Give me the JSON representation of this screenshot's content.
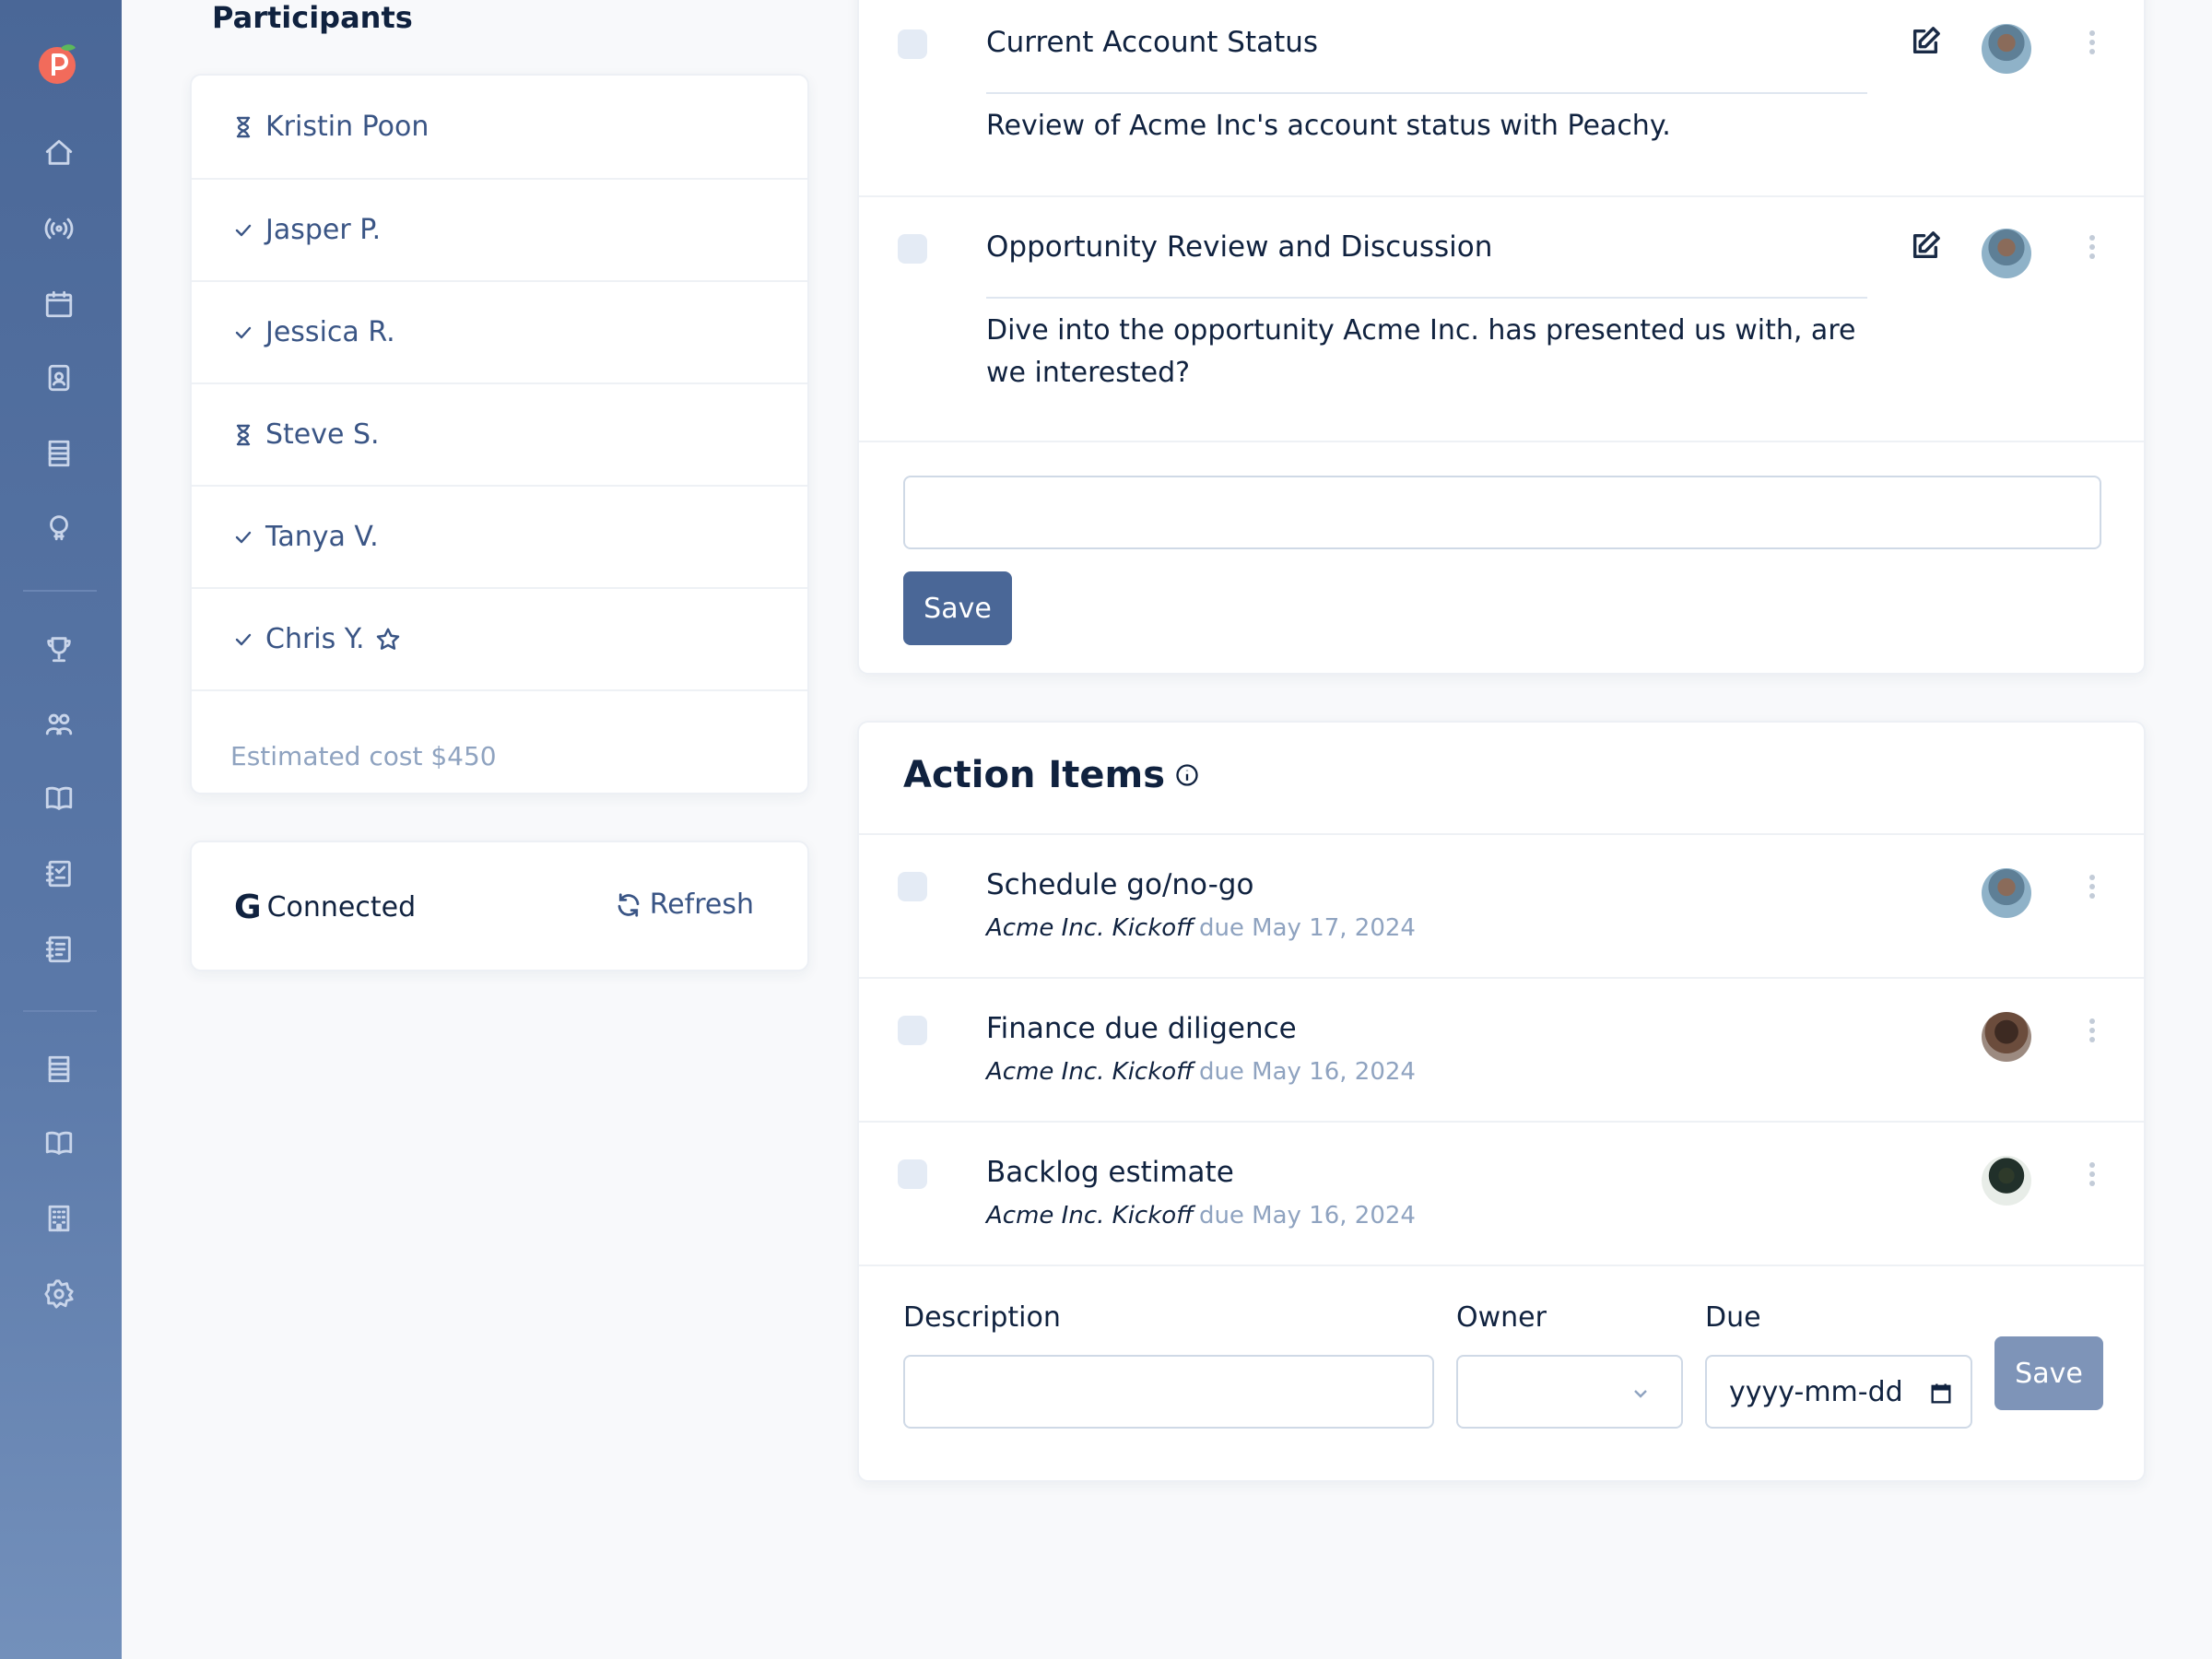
{
  "participants": {
    "title": "Participants",
    "people": [
      {
        "name": "Kristin Poon",
        "status": "pending"
      },
      {
        "name": "Jasper P.",
        "status": "accepted"
      },
      {
        "name": "Jessica R.",
        "status": "accepted"
      },
      {
        "name": "Steve S.",
        "status": "pending"
      },
      {
        "name": "Tanya V.",
        "status": "accepted"
      },
      {
        "name": "Chris Y.",
        "status": "accepted",
        "starred": true
      }
    ],
    "estimated_cost": "Estimated cost $450"
  },
  "calendar": {
    "google_logo": "G",
    "status": "Connected",
    "refresh_label": "Refresh"
  },
  "agenda": {
    "items": [
      {
        "title": "Current Account Status",
        "description": "Review of Acme Inc's account status with Peachy."
      },
      {
        "title": "Opportunity Review and Discussion",
        "description": "Dive into the opportunity Acme Inc. has presented us with, are we interested?"
      }
    ],
    "new_item_value": "",
    "save_label": "Save"
  },
  "action_items": {
    "title": "Action Items",
    "items": [
      {
        "title": "Schedule go/no-go",
        "meeting": "Acme Inc. Kickoff",
        "due": "due May 17, 2024"
      },
      {
        "title": "Finance due diligence",
        "meeting": "Acme Inc. Kickoff",
        "due": "due May 16, 2024"
      },
      {
        "title": "Backlog estimate",
        "meeting": "Acme Inc. Kickoff",
        "due": "due May 16, 2024"
      }
    ],
    "form": {
      "description_label": "Description",
      "owner_label": "Owner",
      "due_label": "Due",
      "due_placeholder": "yyyy-mm-dd",
      "save_label": "Save"
    }
  },
  "colors": {
    "sidebar": "#4a6797",
    "accent": "#4a6797",
    "muted_text": "#8fa3c0",
    "logo": "#f26b5b"
  },
  "sidebar": {
    "icons": [
      "home-icon",
      "broadcast-icon",
      "calendar-icon",
      "contact-icon",
      "list-icon",
      "lightbulb-icon",
      "trophy-icon",
      "people-icon",
      "book-icon",
      "checklist-icon",
      "notes-icon",
      "list-icon",
      "book-icon",
      "building-icon",
      "gear-icon"
    ]
  }
}
